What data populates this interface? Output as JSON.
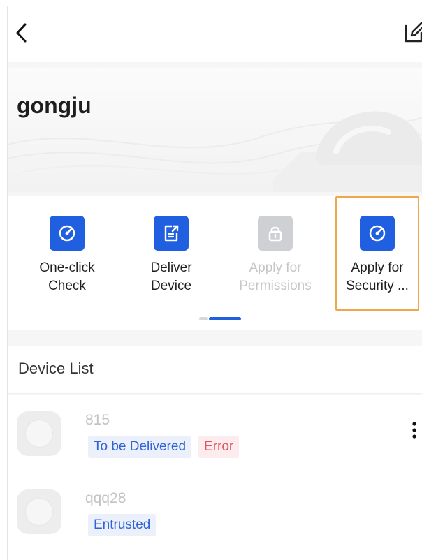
{
  "nav": {
    "back_icon": "chevron-left-icon",
    "edit_icon": "edit-icon"
  },
  "header": {
    "title": "gongju"
  },
  "actions": [
    {
      "line1": "One-click",
      "line2": "Check",
      "icon": "gauge-icon",
      "enabled": true,
      "highlighted": false
    },
    {
      "line1": "Deliver",
      "line2": "Device",
      "icon": "export-document-icon",
      "enabled": true,
      "highlighted": false
    },
    {
      "line1": "Apply for",
      "line2": "Permissions",
      "icon": "lock-icon",
      "enabled": false,
      "highlighted": false
    },
    {
      "line1": "Apply for",
      "line2": "Security ...",
      "icon": "gauge-icon",
      "enabled": true,
      "highlighted": true
    }
  ],
  "pager": {
    "pages": 2,
    "current": 2
  },
  "device_list": {
    "title": "Device List",
    "devices": [
      {
        "name": "815",
        "tags": [
          {
            "text": "To be Delivered",
            "color": "#2f63d8"
          },
          {
            "text": "Error",
            "color": "#e0555f"
          }
        ]
      },
      {
        "name": "qqq28",
        "tags": [
          {
            "text": "Entrusted",
            "color": "#2f63d8"
          }
        ]
      }
    ]
  },
  "colors": {
    "accent": "#1f5fe0",
    "disabled": "#cfd0d3",
    "highlight_border": "#f0a64a",
    "error": "#e0555f"
  }
}
